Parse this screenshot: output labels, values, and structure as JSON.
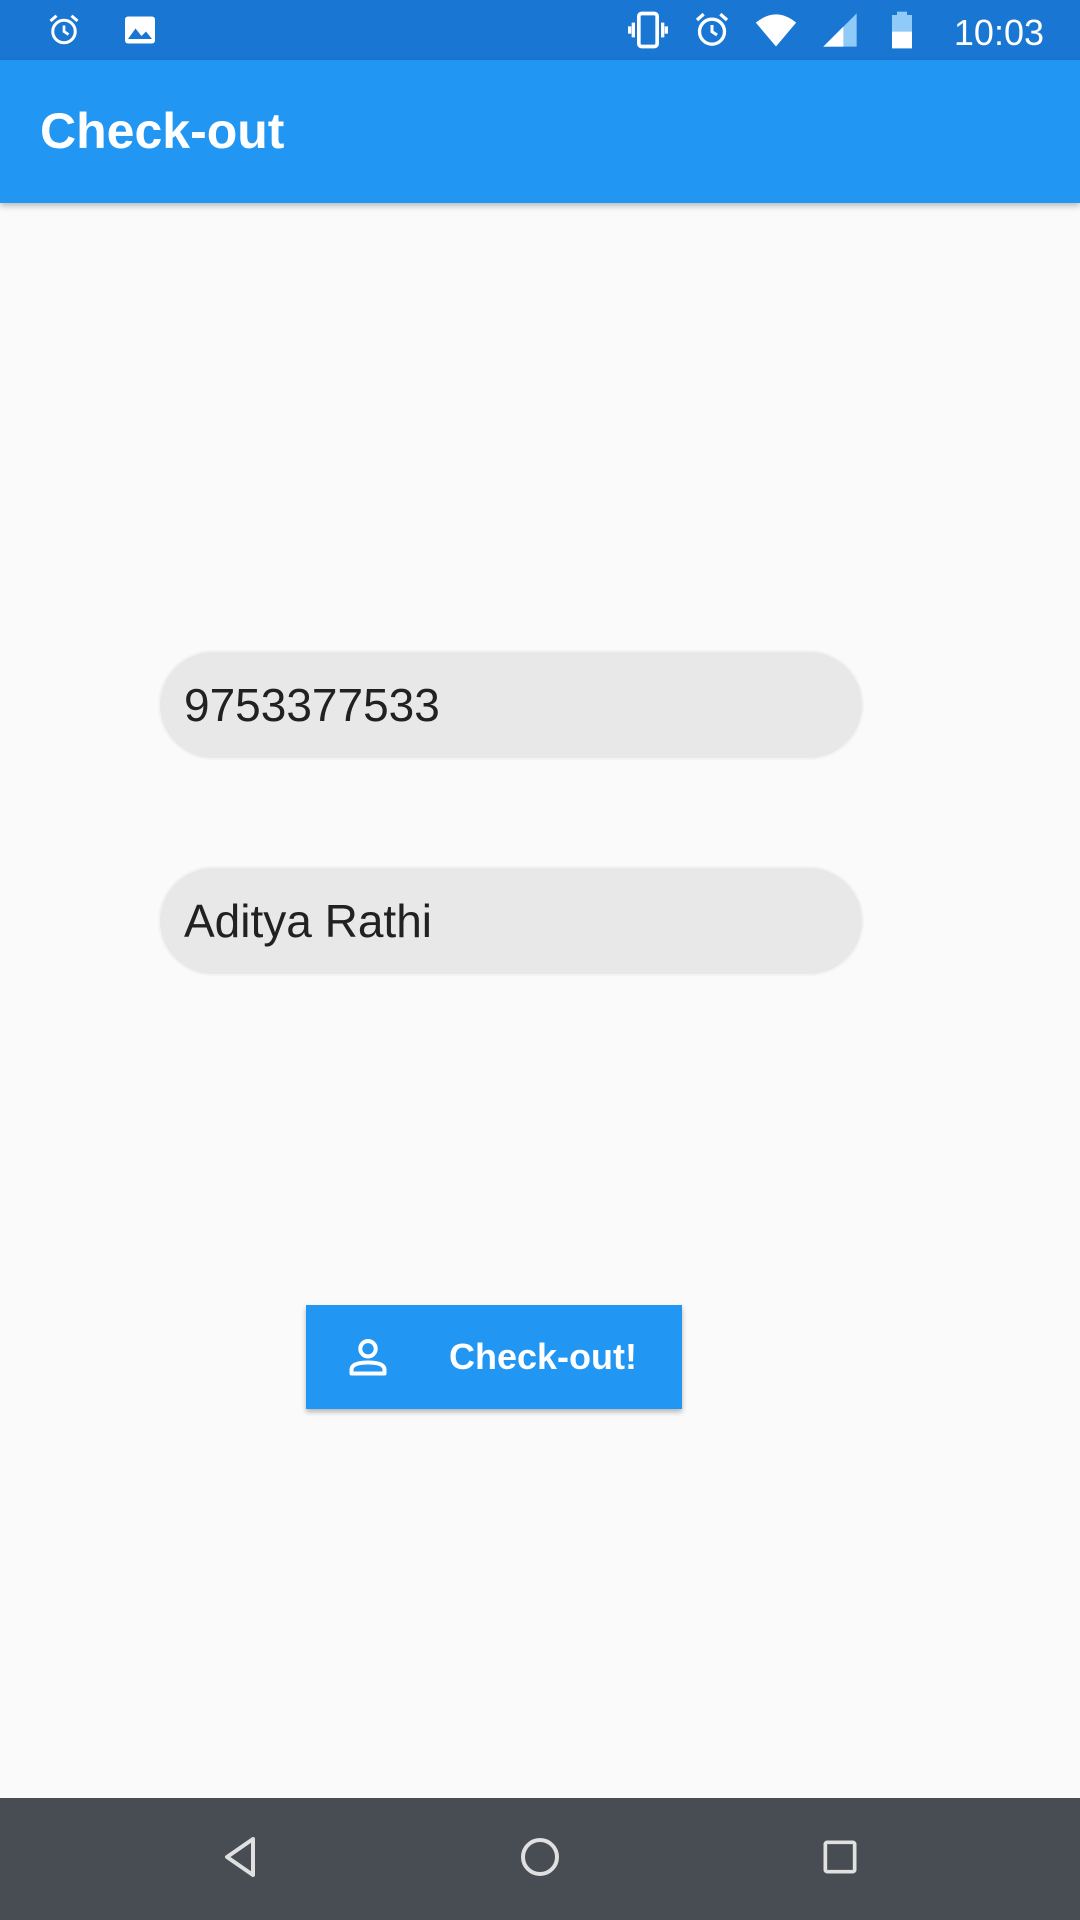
{
  "status_bar": {
    "time": "10:03",
    "icons": [
      "alarm-icon",
      "image-icon",
      "vibrate-icon",
      "alarm-icon",
      "wifi-icon",
      "signal-icon",
      "battery-icon"
    ]
  },
  "app_bar": {
    "title": "Check-out"
  },
  "form": {
    "phone_value": "9753377533",
    "name_value": "Aditya Rathi"
  },
  "checkout_button": {
    "label": "Check-out!",
    "icon": "person-icon"
  },
  "nav_bar": {
    "icons": [
      "back-icon",
      "home-icon",
      "recents-icon"
    ]
  },
  "colors": {
    "status_bar": "#1976d2",
    "app_bar": "#2196f3",
    "button": "#2196f3",
    "background": "#fafafa",
    "input_background": "#e8e8e8",
    "nav_bar": "#474d52"
  }
}
